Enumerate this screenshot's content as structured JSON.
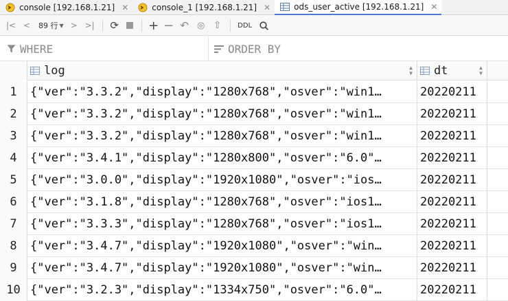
{
  "tabs": [
    {
      "label": "console [192.168.1.21]",
      "icon": "console-icon",
      "active": false
    },
    {
      "label": "console_1 [192.168.1.21]",
      "icon": "console-icon",
      "active": false
    },
    {
      "label": "ods_user_active [192.168.1.21]",
      "icon": "table-icon",
      "active": true
    }
  ],
  "toolbar": {
    "rows_count": "89 行",
    "ddl_label": "DDL"
  },
  "filter": {
    "where_placeholder": "WHERE",
    "order_placeholder": "ORDER BY"
  },
  "grid": {
    "columns": [
      {
        "name": "log"
      },
      {
        "name": "dt"
      }
    ],
    "rows": [
      {
        "num": "1",
        "log": "{\"ver\":\"3.3.2\",\"display\":\"1280x768\",\"osver\":\"win1…",
        "dt": "20220211"
      },
      {
        "num": "2",
        "log": "{\"ver\":\"3.3.2\",\"display\":\"1280x768\",\"osver\":\"win1…",
        "dt": "20220211"
      },
      {
        "num": "3",
        "log": "{\"ver\":\"3.3.2\",\"display\":\"1280x768\",\"osver\":\"win1…",
        "dt": "20220211"
      },
      {
        "num": "4",
        "log": "{\"ver\":\"3.4.1\",\"display\":\"1280x800\",\"osver\":\"6.0\"…",
        "dt": "20220211"
      },
      {
        "num": "5",
        "log": "{\"ver\":\"3.0.0\",\"display\":\"1920x1080\",\"osver\":\"ios…",
        "dt": "20220211"
      },
      {
        "num": "6",
        "log": "{\"ver\":\"3.1.8\",\"display\":\"1280x768\",\"osver\":\"ios1…",
        "dt": "20220211"
      },
      {
        "num": "7",
        "log": "{\"ver\":\"3.3.3\",\"display\":\"1280x768\",\"osver\":\"ios1…",
        "dt": "20220211"
      },
      {
        "num": "8",
        "log": "{\"ver\":\"3.4.7\",\"display\":\"1920x1080\",\"osver\":\"win…",
        "dt": "20220211"
      },
      {
        "num": "9",
        "log": "{\"ver\":\"3.4.7\",\"display\":\"1920x1080\",\"osver\":\"win…",
        "dt": "20220211"
      },
      {
        "num": "10",
        "log": "{\"ver\":\"3.2.3\",\"display\":\"1334x750\",\"osver\":\"6.0\"…",
        "dt": "20220211"
      }
    ]
  },
  "colors": {
    "accent": "#4a7bd0",
    "console_icon": "#d4a017"
  }
}
